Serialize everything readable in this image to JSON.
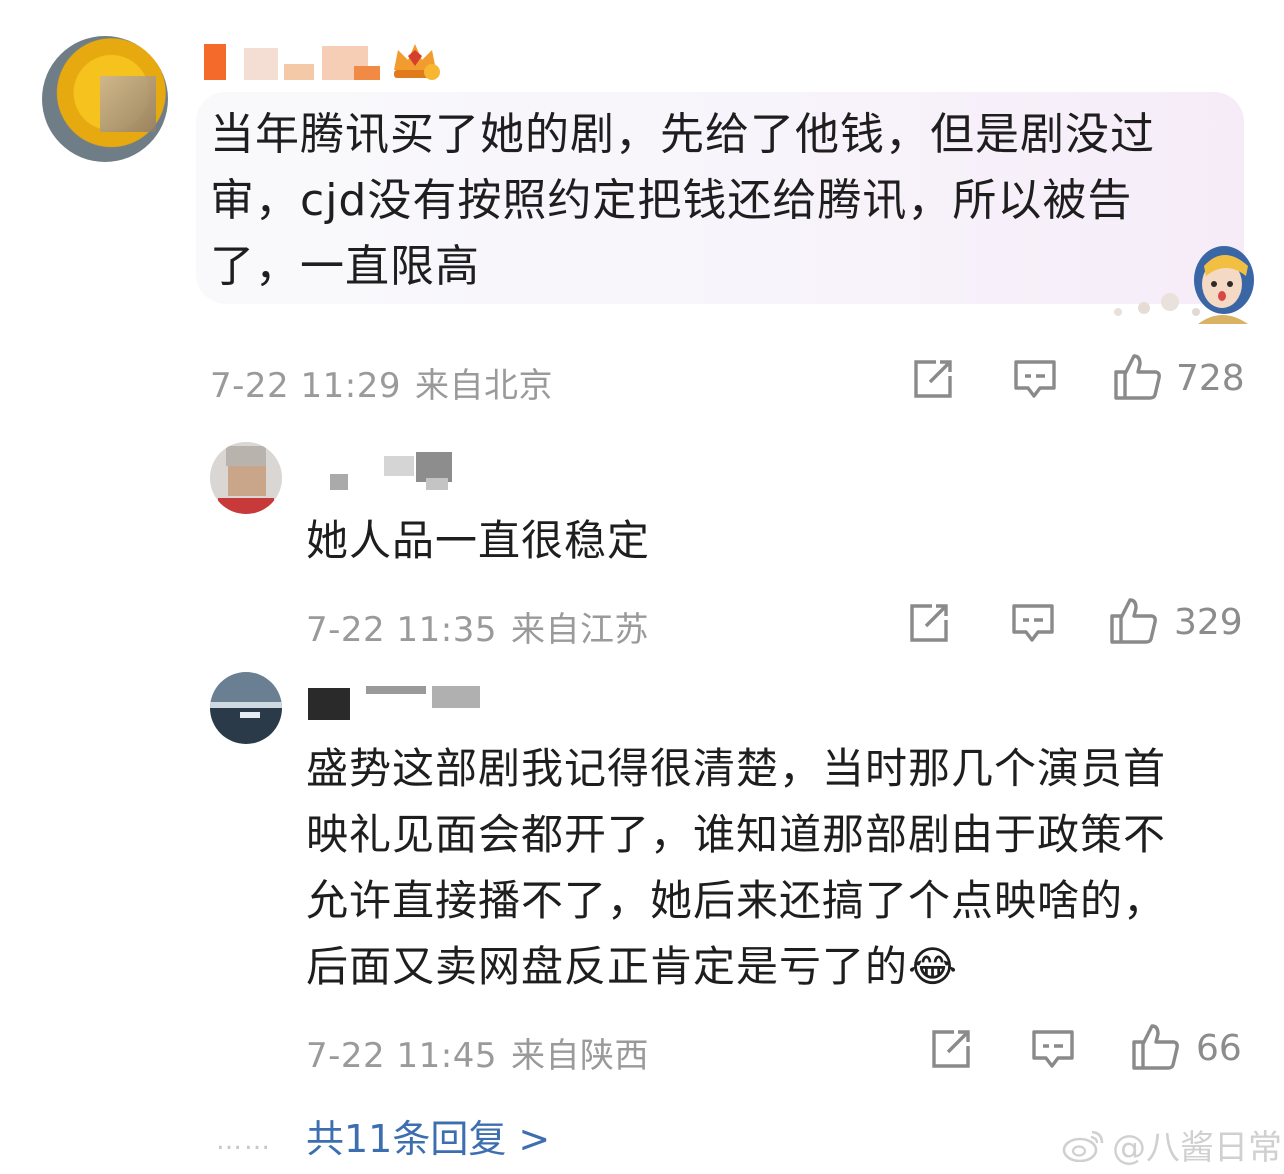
{
  "main_comment": {
    "text": "当年腾讯买了她的剧，先给了他钱，但是剧没过审，cjd没有按照约定把钱还给腾讯，所以被告了，一直限高",
    "time": "7-22 11:29",
    "location": "来自北京",
    "likes": "728"
  },
  "replies": [
    {
      "text": "她人品一直很稳定",
      "time": "7-22 11:35",
      "location": "来自江苏",
      "likes": "329"
    },
    {
      "text": "盛势这部剧我记得很清楚，当时那几个演员首映礼见面会都开了，谁知道那部剧由于政策不允许直接播不了，她后来还搞了个点映啥的，后面又卖网盘反正肯定是亏了的",
      "emoji": "😂",
      "time": "7-22 11:45",
      "location": "来自陕西",
      "likes": "66"
    }
  ],
  "more_replies": {
    "dots": "……",
    "label": "共11条回复 >"
  },
  "watermark": {
    "handle": "@八酱日常"
  },
  "icons": {
    "repost": "repost-icon",
    "comment": "comment-icon",
    "like": "thumbs-up-icon",
    "crown": "crown-badge-icon"
  },
  "colors": {
    "link": "#3d6eb0",
    "meta": "#9a9a9a",
    "bubble_end": "#f6ecf8"
  }
}
